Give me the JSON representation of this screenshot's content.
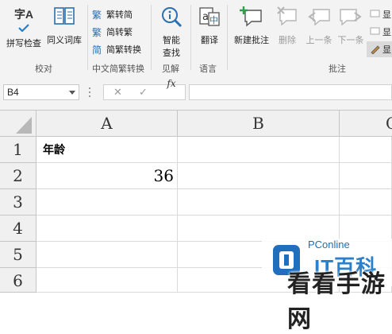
{
  "ribbon": {
    "proof": {
      "spelling_icon_text": "字A",
      "spelling_label": "拼写检查",
      "thesaurus_label": "同义词库",
      "group_label": "校对"
    },
    "chinese": {
      "trad_to_simp": "繁转简",
      "simp_to_trad": "简转繁",
      "convert": "简繁转换",
      "group_label": "中文简繁转换"
    },
    "insights": {
      "smart_lookup_line1": "智能",
      "smart_lookup_line2": "查找",
      "group_label": "见解"
    },
    "language": {
      "translate_label": "翻译",
      "group_label": "语言"
    },
    "comments": {
      "new_comment": "新建批注",
      "delete": "删除",
      "previous": "上一条",
      "next": "下一条",
      "show1": "显",
      "show2": "显",
      "show3": "显",
      "group_label": "批注"
    }
  },
  "formula_bar": {
    "name_box": "B4",
    "cancel_glyph": "✕",
    "enter_glyph": "✓",
    "fx_label": "fx",
    "formula": ""
  },
  "grid": {
    "columns": [
      "A",
      "B",
      "C"
    ],
    "rows": [
      "1",
      "2",
      "3",
      "4",
      "5",
      "6"
    ],
    "cells": {
      "A1": "年龄",
      "A2": "36"
    }
  },
  "watermarks": {
    "pconline": "PConline",
    "brand": "IT百科",
    "site": "看看手游网"
  },
  "colors": {
    "accent_blue": "#2a80c9",
    "ribbon_bg": "#f3f3f3",
    "header_bg": "#f0f0f0",
    "gridline": "#dadada"
  }
}
